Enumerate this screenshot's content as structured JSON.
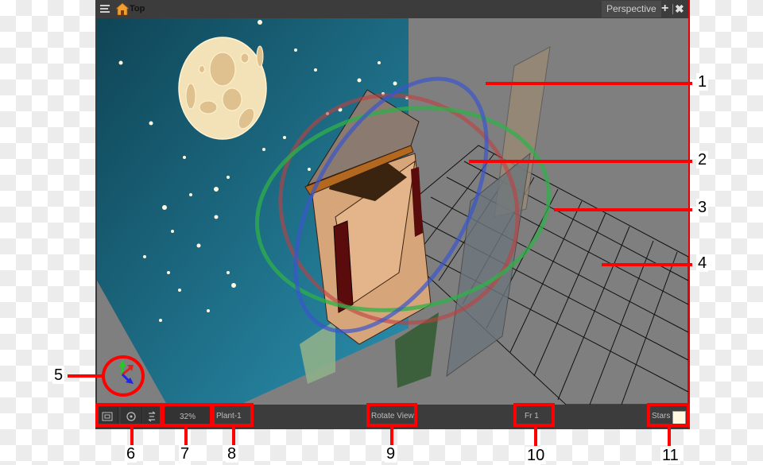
{
  "window": {
    "menu_icon": "hamburger-menu-icon",
    "home_icon": "home-icon",
    "title": "Top",
    "view_mode_tab": "Perspective",
    "add_view_icon": "plus-icon",
    "close_view_icon": "close-icon"
  },
  "scene": {
    "description": "Camera view of a pagoda-style tower scene with moon and stars; 3D rotation handles (red, green, blue rings), grid and layer planes shown in perspective",
    "colors": {
      "sky_top": "#0f4556",
      "sky_bottom": "#2a8fae",
      "backdrop_grey": "#7f7f7f",
      "moon": "#f3e2b8",
      "ring_red": "#c04040",
      "ring_green": "#2fb04a",
      "ring_blue": "#3a55cc"
    },
    "axis_gizmo_icon": "xyz-axis-gizmo-icon"
  },
  "statusbar": {
    "buttons": [
      {
        "name": "toggle-safe-area-button",
        "icon": "safe-area-icon"
      },
      {
        "name": "reset-rotation-button",
        "icon": "reset-rotation-icon"
      },
      {
        "name": "reset-view-button",
        "icon": "reset-view-icon"
      }
    ],
    "zoom_level": "32%",
    "current_element": "Plant-1",
    "rotate_view": "Rotate View",
    "frame": "Fr 1",
    "background_color_label": "Stars",
    "background_color_swatch": "#fff8de"
  },
  "callouts": {
    "color": "#ff0000",
    "labels": [
      "1",
      "2",
      "3",
      "4",
      "5",
      "6",
      "7",
      "8",
      "9",
      "10",
      "11"
    ]
  }
}
